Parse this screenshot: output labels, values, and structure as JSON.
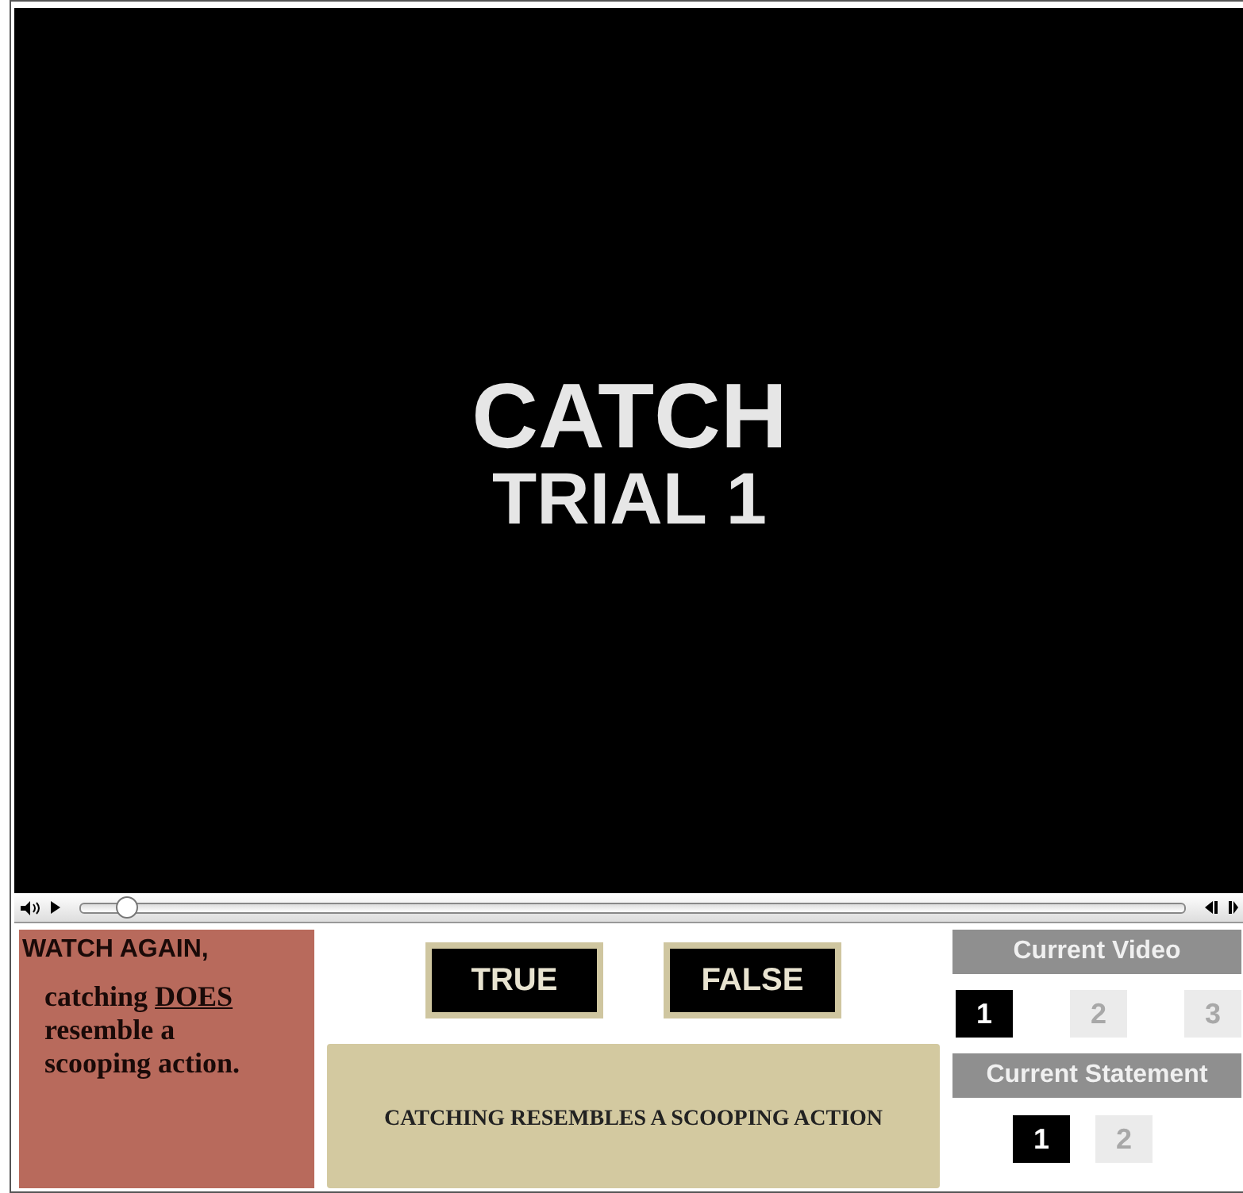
{
  "video": {
    "lines": [
      "CATCH",
      "TRIAL 1"
    ]
  },
  "player": {
    "seek": {
      "level": 0.04
    }
  },
  "feedback": {
    "heading": "WATCH AGAIN,",
    "before": "catching",
    "emphasis": "DOES",
    "after": "resemble a scooping action."
  },
  "answers": [
    {
      "label": "TRUE"
    },
    {
      "label": "FALSE"
    }
  ],
  "statement": "CATCHING RESEMBLES A SCOOPING ACTION",
  "current_video": {
    "title": "Current Video",
    "items": [
      {
        "label": "1",
        "selected": true
      },
      {
        "label": "2",
        "selected": false
      },
      {
        "label": "3",
        "selected": false
      }
    ]
  },
  "current_statement": {
    "title": "Current Statement",
    "items": [
      {
        "label": "1",
        "selected": true
      },
      {
        "label": "2",
        "selected": false
      }
    ]
  }
}
